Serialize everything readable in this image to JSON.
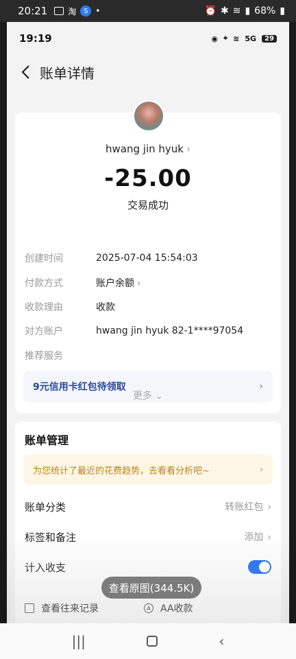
{
  "outer_status": {
    "time": "20:21",
    "left_badge": "淘",
    "battery": "68%"
  },
  "inner_status": {
    "time": "19:19",
    "net": "5G",
    "battery": "29"
  },
  "nav": {
    "title": "账单详情"
  },
  "payee": {
    "name": "hwang jin hyuk"
  },
  "transaction": {
    "amount": "-25.00",
    "status": "交易成功"
  },
  "details": [
    {
      "key": "创建时间",
      "value": "2025-07-04 15:54:03",
      "link": false
    },
    {
      "key": "付款方式",
      "value": "账户余额",
      "link": true
    },
    {
      "key": "收款理由",
      "value": "收款",
      "link": false
    },
    {
      "key": "对方账户",
      "value": "hwang jin hyuk 82-1****97054",
      "link": false
    },
    {
      "key": "推荐服务",
      "value": "",
      "link": false
    }
  ],
  "promo": {
    "label": "9元信用卡红包待领取"
  },
  "more": {
    "label": "更多"
  },
  "bill_mgmt": {
    "title": "账单管理",
    "tip": "为您统计了最近的花费趋势，去看看分析吧~",
    "category": {
      "label": "账单分类",
      "value": "转账红包"
    },
    "tags": {
      "label": "标签和备注",
      "value": "添加"
    },
    "include": {
      "label": "计入收支",
      "on": true
    },
    "actions": {
      "history": "查看往来记录",
      "aa": "AA收款"
    }
  },
  "overlay": {
    "view_original": "查看原图(344.5K)"
  },
  "colors": {
    "accent": "#1e6df6",
    "promo_text": "#2a4a9a",
    "tip_text": "#b8861f"
  }
}
